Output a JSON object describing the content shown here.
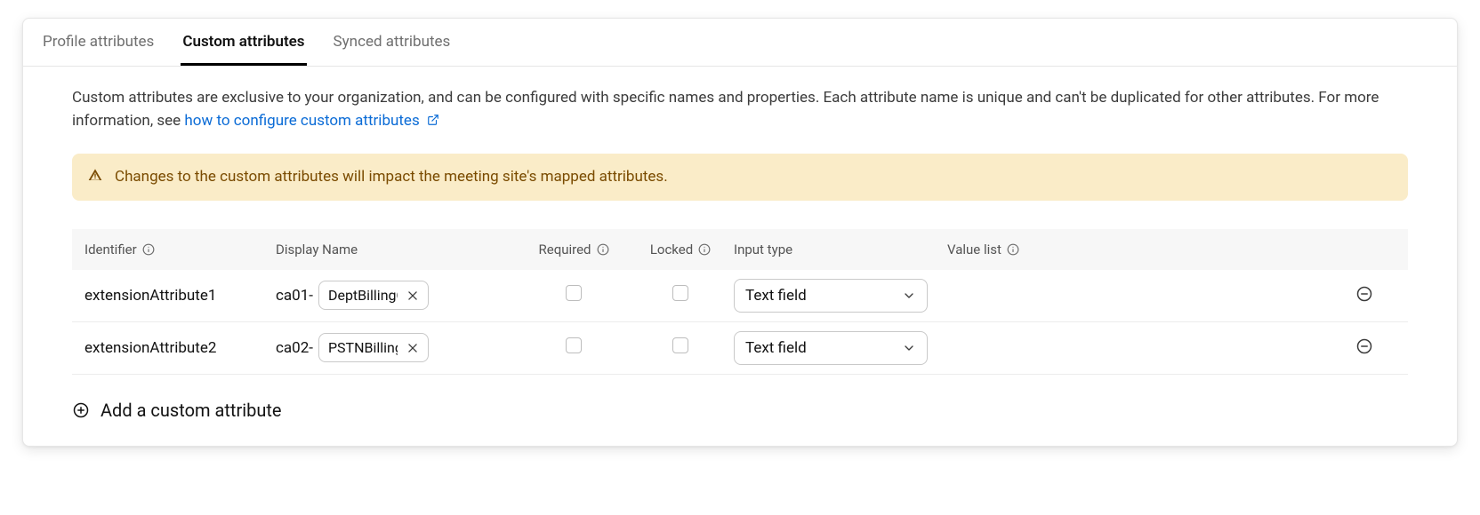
{
  "tabs": {
    "profile": "Profile attributes",
    "custom": "Custom attributes",
    "synced": "Synced attributes"
  },
  "intro": {
    "text_a": "Custom attributes are exclusive to your organization, and can be configured with specific names and properties. Each attribute name is unique and can't be duplicated for other attributes. For more information, see ",
    "link_text": "how to configure custom attributes"
  },
  "alert": {
    "text": "Changes to the custom attributes will impact the meeting site's mapped attributes."
  },
  "columns": {
    "identifier": "Identifier",
    "display_name": "Display Name",
    "required": "Required",
    "locked": "Locked",
    "input_type": "Input type",
    "value_list": "Value list"
  },
  "rows": [
    {
      "identifier": "extensionAttribute1",
      "prefix": "ca01-",
      "display_value": "DeptBillingCode",
      "input_type": "Text field"
    },
    {
      "identifier": "extensionAttribute2",
      "prefix": "ca02-",
      "display_value": "PSTNBillingCode",
      "input_type": "Text field"
    }
  ],
  "add_button": "Add a custom attribute"
}
